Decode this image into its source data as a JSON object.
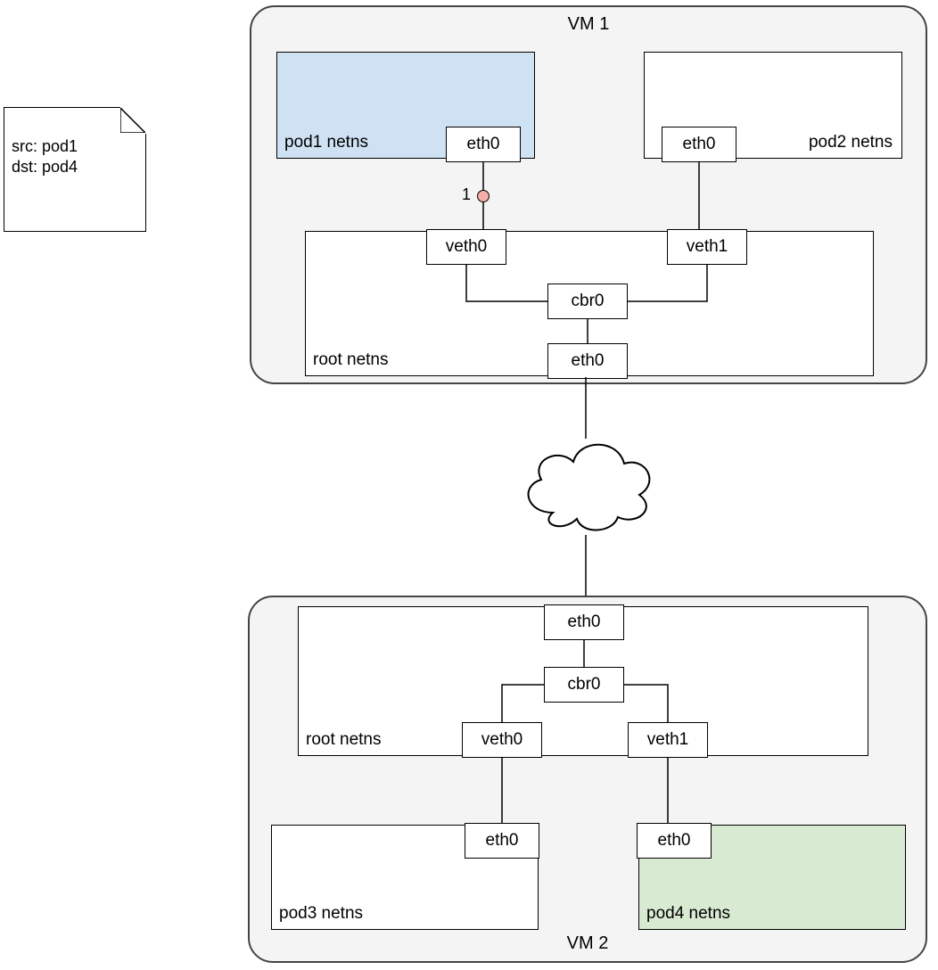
{
  "note": {
    "src": "src: pod1",
    "dst": "dst: pod4"
  },
  "vm1": {
    "title": "VM 1",
    "pod1": {
      "label": "pod1 netns",
      "eth": "eth0"
    },
    "pod2": {
      "label": "pod2 netns",
      "eth": "eth0"
    },
    "root": {
      "label": "root netns",
      "veth0": "veth0",
      "veth1": "veth1",
      "cbr0": "cbr0",
      "eth0": "eth0"
    },
    "step1": "1"
  },
  "vm2": {
    "title": "VM 2",
    "root": {
      "label": "root netns",
      "eth0": "eth0",
      "cbr0": "cbr0",
      "veth0": "veth0",
      "veth1": "veth1"
    },
    "pod3": {
      "label": "pod3 netns",
      "eth": "eth0"
    },
    "pod4": {
      "label": "pod4 netns",
      "eth": "eth0"
    }
  }
}
